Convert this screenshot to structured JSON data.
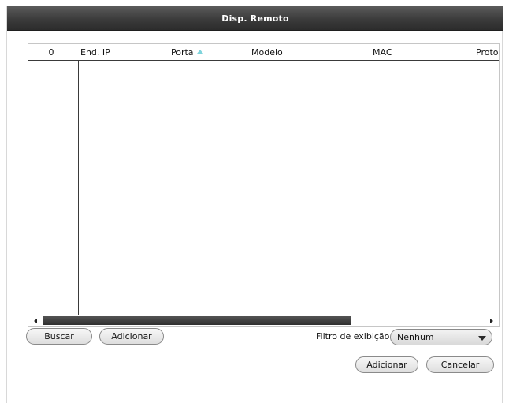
{
  "dialog": {
    "title": "Disp. Remoto"
  },
  "table": {
    "columns": [
      {
        "label": "0"
      },
      {
        "label": "End. IP"
      },
      {
        "label": "Porta",
        "sort": "ascending"
      },
      {
        "label": "Modelo"
      },
      {
        "label": "MAC"
      },
      {
        "label": "Proto"
      }
    ],
    "rows": []
  },
  "buttons": {
    "search": "Buscar",
    "add_top": "Adicionar",
    "add": "Adicionar",
    "cancel": "Cancelar"
  },
  "filter": {
    "label": "Filtro de exibição",
    "value": "Nenhum"
  },
  "colors": {
    "titlebar": "#3b3b3b",
    "sort_arrow": "#7fd4dc",
    "scroll_thumb": "#3d3d3d"
  }
}
